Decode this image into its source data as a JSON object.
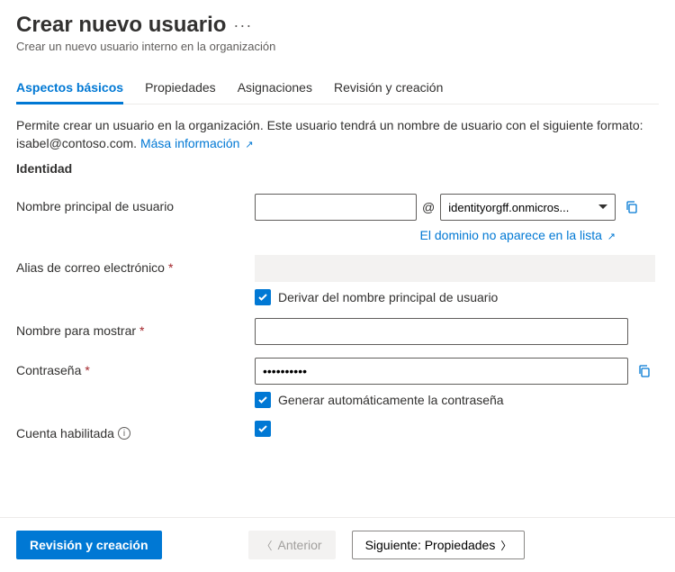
{
  "header": {
    "title": "Crear nuevo usuario",
    "subtitle": "Crear un nuevo usuario interno en la organización"
  },
  "tabs": [
    {
      "label": "Aspectos básicos",
      "active": true
    },
    {
      "label": "Propiedades",
      "active": false
    },
    {
      "label": "Asignaciones",
      "active": false
    },
    {
      "label": "Revisión y creación",
      "active": false
    }
  ],
  "description": {
    "text": "Permite crear un usuario en la organización. Este usuario tendrá un nombre de usuario con el siguiente formato: isabel@contoso.com. ",
    "link_text": "Mása información"
  },
  "section": {
    "identity_title": "Identidad"
  },
  "fields": {
    "upn": {
      "label": "Nombre principal de usuario",
      "value": "",
      "at": "@",
      "domain_selected": "identityorgff.onmicros...",
      "domain_missing_link": "El dominio no aparece en la lista"
    },
    "alias": {
      "label": "Alias de correo electrónico",
      "derive_label": "Derivar del nombre principal de usuario"
    },
    "display_name": {
      "label": "Nombre para mostrar",
      "value": ""
    },
    "password": {
      "label": "Contraseña",
      "value": "••••••••••",
      "auto_label": "Generar automáticamente la contraseña"
    },
    "enabled": {
      "label": "Cuenta habilitada"
    }
  },
  "footer": {
    "review": "Revisión y creación",
    "previous": "Anterior",
    "next": "Siguiente: Propiedades"
  }
}
